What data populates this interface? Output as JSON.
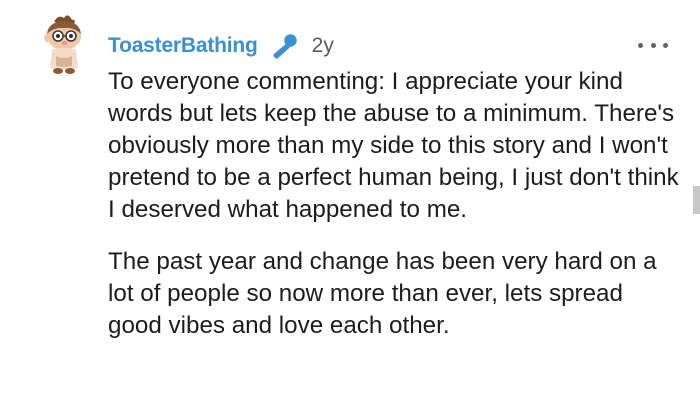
{
  "comment": {
    "username": "ToasterBathing",
    "age": "2y",
    "paragraphs": [
      "To everyone commenting: I appreciate your kind words but lets keep the abuse to a minimum. There's obviously more than my side to this story and I won't pretend to be a perfect human being, I just don't think I deserved what happened to me.",
      "The past year and change has been very hard on a lot of people so now more than ever, lets spread good vibes and love each other."
    ]
  },
  "icons": {
    "author_badge": "microphone-icon",
    "overflow_menu": "more-options-icon",
    "avatar": "snoo-avatar"
  },
  "colors": {
    "username": "#3b8fd6",
    "badge": "#3b8fd6",
    "text": "#1c1c1c",
    "meta": "#555a5e"
  }
}
